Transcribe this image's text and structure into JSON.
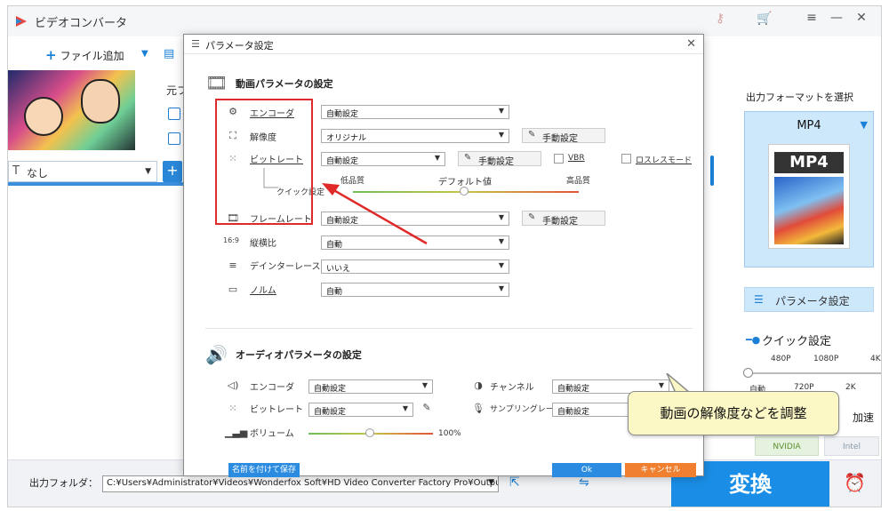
{
  "app": {
    "title": "ビデオコンバータ"
  },
  "toolbar": {
    "add_file": "ファイル追加"
  },
  "file": {
    "label_prefix": "元フ",
    "subtitle_value": "なし"
  },
  "bottom": {
    "output_folder_label": "出力フォルダ：",
    "output_path": "C:¥Users¥Administrator¥Videos¥Wonderfox Soft¥HD Video Converter Factory Pro¥OutputVideo¥",
    "convert_label": "変換"
  },
  "right_panel": {
    "format_title": "出力フォーマットを選択",
    "format_name": "MP4",
    "format_image_text": "MP4",
    "param_button": "パラメータ設定",
    "quick_title": "クイック設定",
    "quick_ticks_top": [
      "480P",
      "1080P",
      "4K"
    ],
    "quick_ticks_bottom": [
      "自動",
      "720P",
      "2K"
    ],
    "quick_level": 0,
    "accel_label": "加速",
    "hw_nvidia": "NVIDIA",
    "hw_intel": "Intel"
  },
  "dialog": {
    "title": "パラメータ設定",
    "video_section": "動画パラメータの設定",
    "video_rows": [
      {
        "label": "エンコーダ",
        "value": "自動設定"
      },
      {
        "label": "解像度",
        "value": "オリジナル"
      },
      {
        "label": "ビットレート",
        "value": "自動設定"
      },
      {
        "label": "フレームレート",
        "value": "自動設定"
      },
      {
        "label": "縦横比",
        "value": "自動"
      },
      {
        "label": "デインターレース",
        "value": "いいえ"
      },
      {
        "label": "ノルム",
        "value": "自動"
      }
    ],
    "manual_button": "手動設定",
    "vbr_label": "VBR",
    "lossless_label": "ロスレスモード",
    "quick_setting_label": "クイック設定",
    "quality_low": "低品質",
    "quality_default": "デフォルト値",
    "quality_high": "高品質",
    "quality_level": 0.5,
    "audio_section": "オーディオパラメータの設定",
    "audio_rows": [
      {
        "label": "エンコーダ",
        "value": "自動設定"
      },
      {
        "label": "ビットレート",
        "value": "自動設定"
      },
      {
        "label": "チャンネル",
        "value": "自動設定"
      },
      {
        "label": "サンプリングレート",
        "value": "自動設定"
      }
    ],
    "volume_label": "ボリューム",
    "volume_value": "100%",
    "save_button": "名前を付けて保存",
    "ok_button": "Ok",
    "cancel_button": "キャンセル"
  },
  "annotation": {
    "callout_text": "動画の解像度などを調整",
    "highlight_color": "#e02a2a"
  },
  "colors": {
    "accent": "#1a8ee6",
    "cancel": "#f08030",
    "format_bg": "#cde7fb"
  }
}
